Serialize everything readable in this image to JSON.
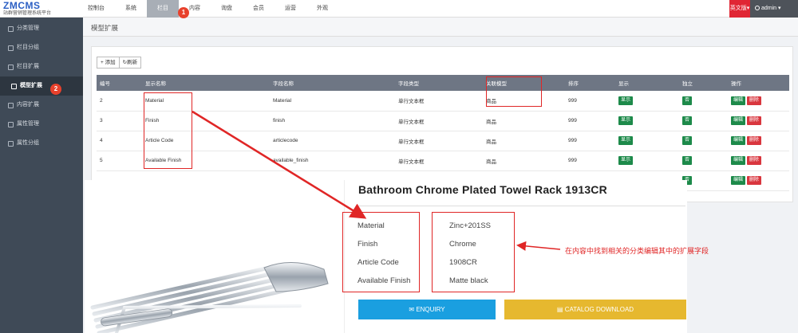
{
  "logo": {
    "brand": "ZMCMS",
    "subtitle": "站群营销管理系统平台"
  },
  "nav": [
    "控制台",
    "系统",
    "栏目",
    "内容",
    "询盘",
    "会员",
    "运营",
    "外观"
  ],
  "nav_active": 2,
  "topright": {
    "lang": "英文版",
    "lang_caret": "▾",
    "user": "admin",
    "user_caret": "▾"
  },
  "sidebar": [
    "分类管理",
    "栏目分组",
    "栏目扩展",
    "模型扩展",
    "内容扩展",
    "属性管理",
    "属性分组"
  ],
  "sidebar_active": 3,
  "page_title": "模型扩展",
  "toolbar": {
    "add": "+ 添加",
    "refresh": "刷新"
  },
  "table": {
    "headers": [
      "编号",
      "显示名称",
      "字段名称",
      "字段类型",
      "关联模型",
      "排序",
      "显示",
      "独立",
      "操作"
    ],
    "rows": [
      [
        "2",
        "Material",
        "Material",
        "单行文本框",
        "商品",
        "999"
      ],
      [
        "3",
        "Finish",
        "finish",
        "单行文本框",
        "商品",
        "999"
      ],
      [
        "4",
        "Article Code",
        "articlecode",
        "单行文本框",
        "商品",
        "999"
      ],
      [
        "5",
        "Available Finish",
        "available_finish",
        "单行文本框",
        "商品",
        "999"
      ]
    ],
    "show_label": "显示",
    "indep_label": "否",
    "edit_label": "编辑",
    "delete_label": "删除"
  },
  "product": {
    "title": "Bathroom Chrome Plated Towel Rack 1913CR",
    "attributes": [
      {
        "name": "Material",
        "value": "Zinc+201SS"
      },
      {
        "name": "Finish",
        "value": "Chrome"
      },
      {
        "name": "Article Code",
        "value": "1908CR"
      },
      {
        "name": "Available Finish",
        "value": "Matte black"
      }
    ],
    "enquiry": "ENQUIRY",
    "catalog": "CATALOG DOWNLOAD"
  },
  "annotations": {
    "step1": "1",
    "step2": "2",
    "note": "在内容中找到相关的分类编辑其中的扩展字段"
  },
  "colors": {
    "accent_red": "#e02626",
    "nav_active": "#a8aeb6",
    "sidebar": "#3f4a57",
    "green": "#1d8a4a",
    "blue_btn": "#1a9fe0",
    "yellow_btn": "#e6b82f"
  },
  "icons": [
    "list-icon",
    "grid-icon",
    "cube-icon",
    "database-icon",
    "refresh-icon",
    "user-icon",
    "mail-icon",
    "document-icon"
  ]
}
